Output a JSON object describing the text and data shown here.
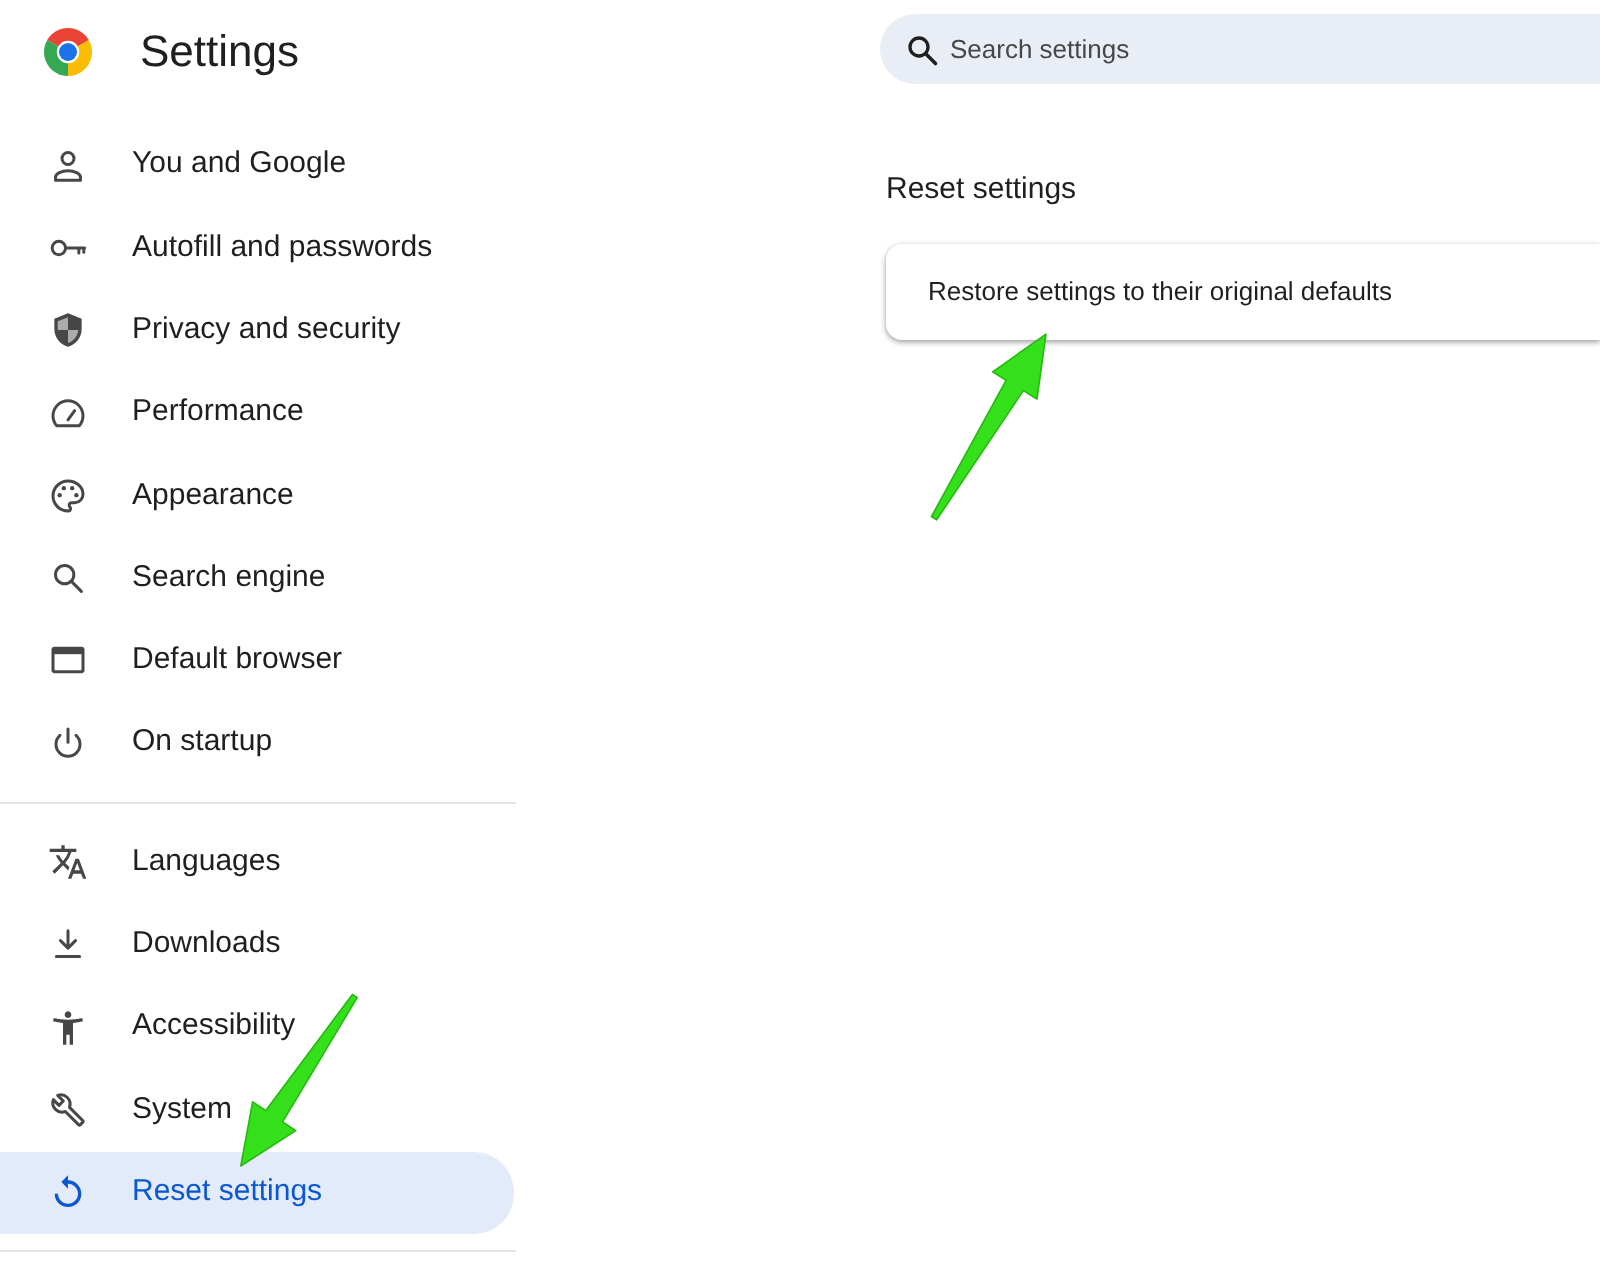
{
  "app": {
    "title": "Settings"
  },
  "search": {
    "placeholder": "Search settings"
  },
  "sidebar": {
    "groups": [
      {
        "items": [
          {
            "label": "You and Google",
            "selected": false
          },
          {
            "label": "Autofill and passwords",
            "selected": false
          },
          {
            "label": "Privacy and security",
            "selected": false
          },
          {
            "label": "Performance",
            "selected": false
          },
          {
            "label": "Appearance",
            "selected": false
          },
          {
            "label": "Search engine",
            "selected": false
          },
          {
            "label": "Default browser",
            "selected": false
          },
          {
            "label": "On startup",
            "selected": false
          }
        ]
      },
      {
        "items": [
          {
            "label": "Languages",
            "selected": false
          },
          {
            "label": "Downloads",
            "selected": false
          },
          {
            "label": "Accessibility",
            "selected": false
          },
          {
            "label": "System",
            "selected": false
          },
          {
            "label": "Reset settings",
            "selected": true
          }
        ]
      }
    ]
  },
  "section": {
    "title": "Reset settings",
    "rows": [
      {
        "label": "Restore settings to their original defaults"
      }
    ]
  },
  "annotations": [
    {
      "kind": "arrow"
    },
    {
      "kind": "arrow"
    }
  ]
}
